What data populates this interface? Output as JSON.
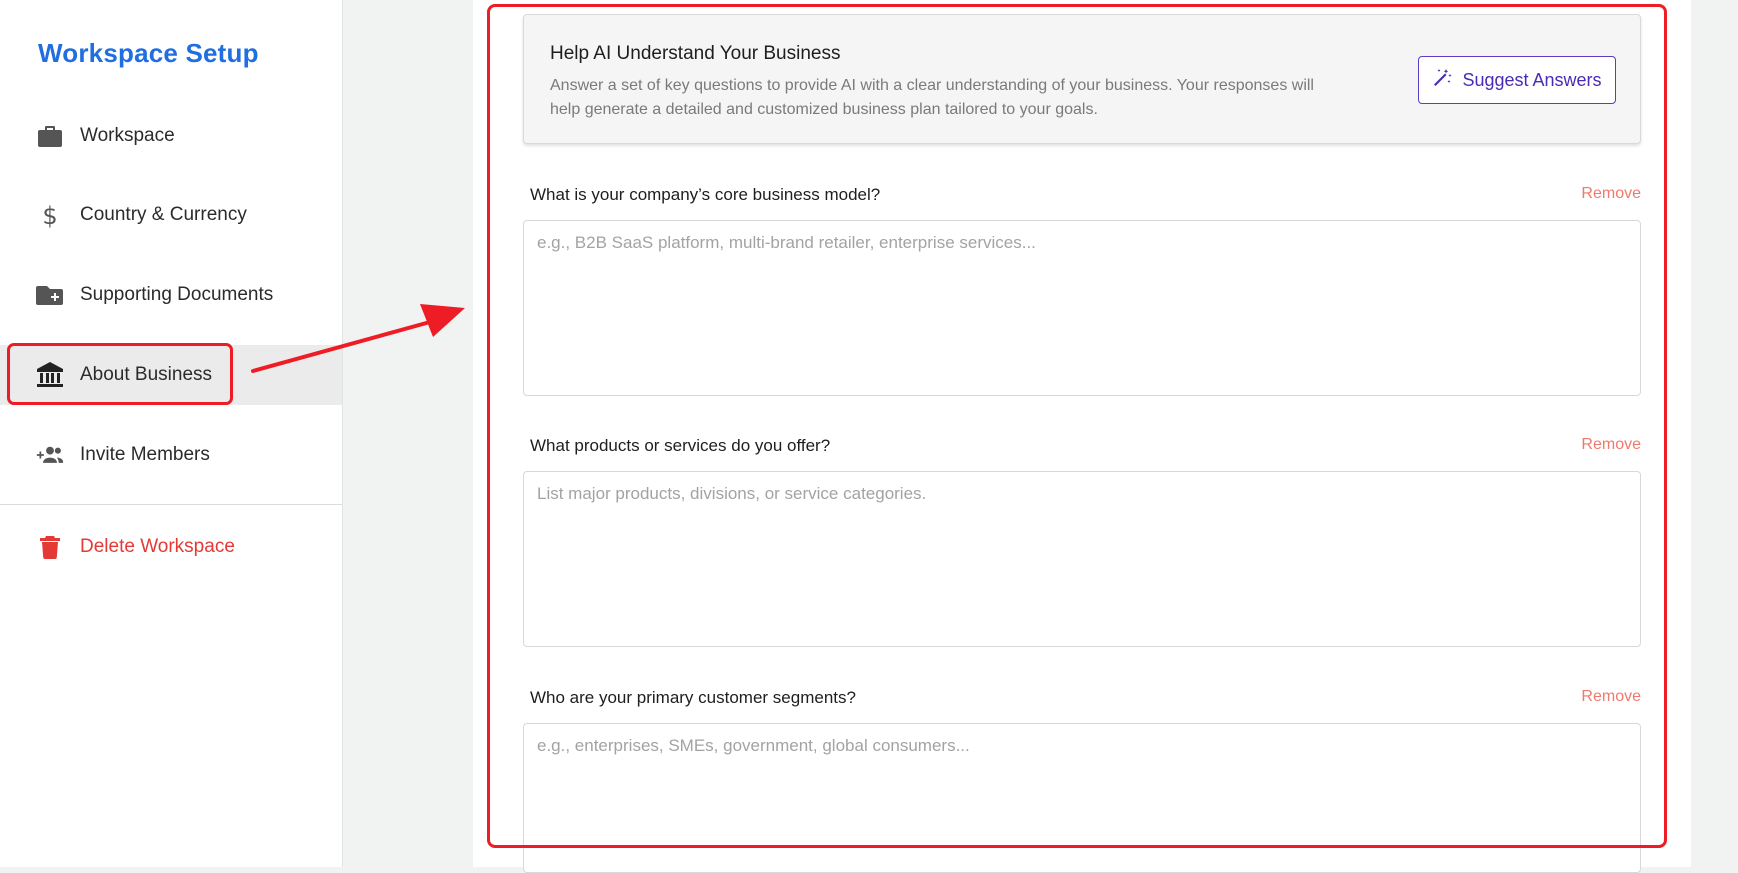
{
  "sidebar": {
    "title": "Workspace Setup",
    "items": [
      {
        "label": "Workspace",
        "icon": "briefcase-icon"
      },
      {
        "label": "Country & Currency",
        "icon": "dollar-icon"
      },
      {
        "label": "Supporting Documents",
        "icon": "folder-plus-icon"
      },
      {
        "label": "About Business",
        "icon": "bank-icon",
        "active": true
      },
      {
        "label": "Invite Members",
        "icon": "group-add-icon"
      }
    ],
    "delete_label": "Delete Workspace"
  },
  "intro": {
    "title": "Help AI Understand Your Business",
    "description": "Answer a set of key questions to provide AI with a clear understanding of your business. Your responses will help generate a detailed and customized business plan tailored to your goals.",
    "suggest_label": "Suggest Answers"
  },
  "questions": [
    {
      "label": "What is your company’s core business model?",
      "placeholder": "e.g., B2B SaaS platform, multi-brand retailer, enterprise services...",
      "value": "",
      "remove_label": "Remove"
    },
    {
      "label": "What products or services do you offer?",
      "placeholder": "List major products, divisions, or service categories.",
      "value": "",
      "remove_label": "Remove"
    },
    {
      "label": "Who are your primary customer segments?",
      "placeholder": "e.g., enterprises, SMEs, government, global consumers...",
      "value": "",
      "remove_label": "Remove"
    }
  ],
  "colors": {
    "brand": "#1f6fe0",
    "accent": "#4a2bb8",
    "danger": "#e53935",
    "remove": "#f0796d",
    "annotation": "#ee1c24"
  }
}
